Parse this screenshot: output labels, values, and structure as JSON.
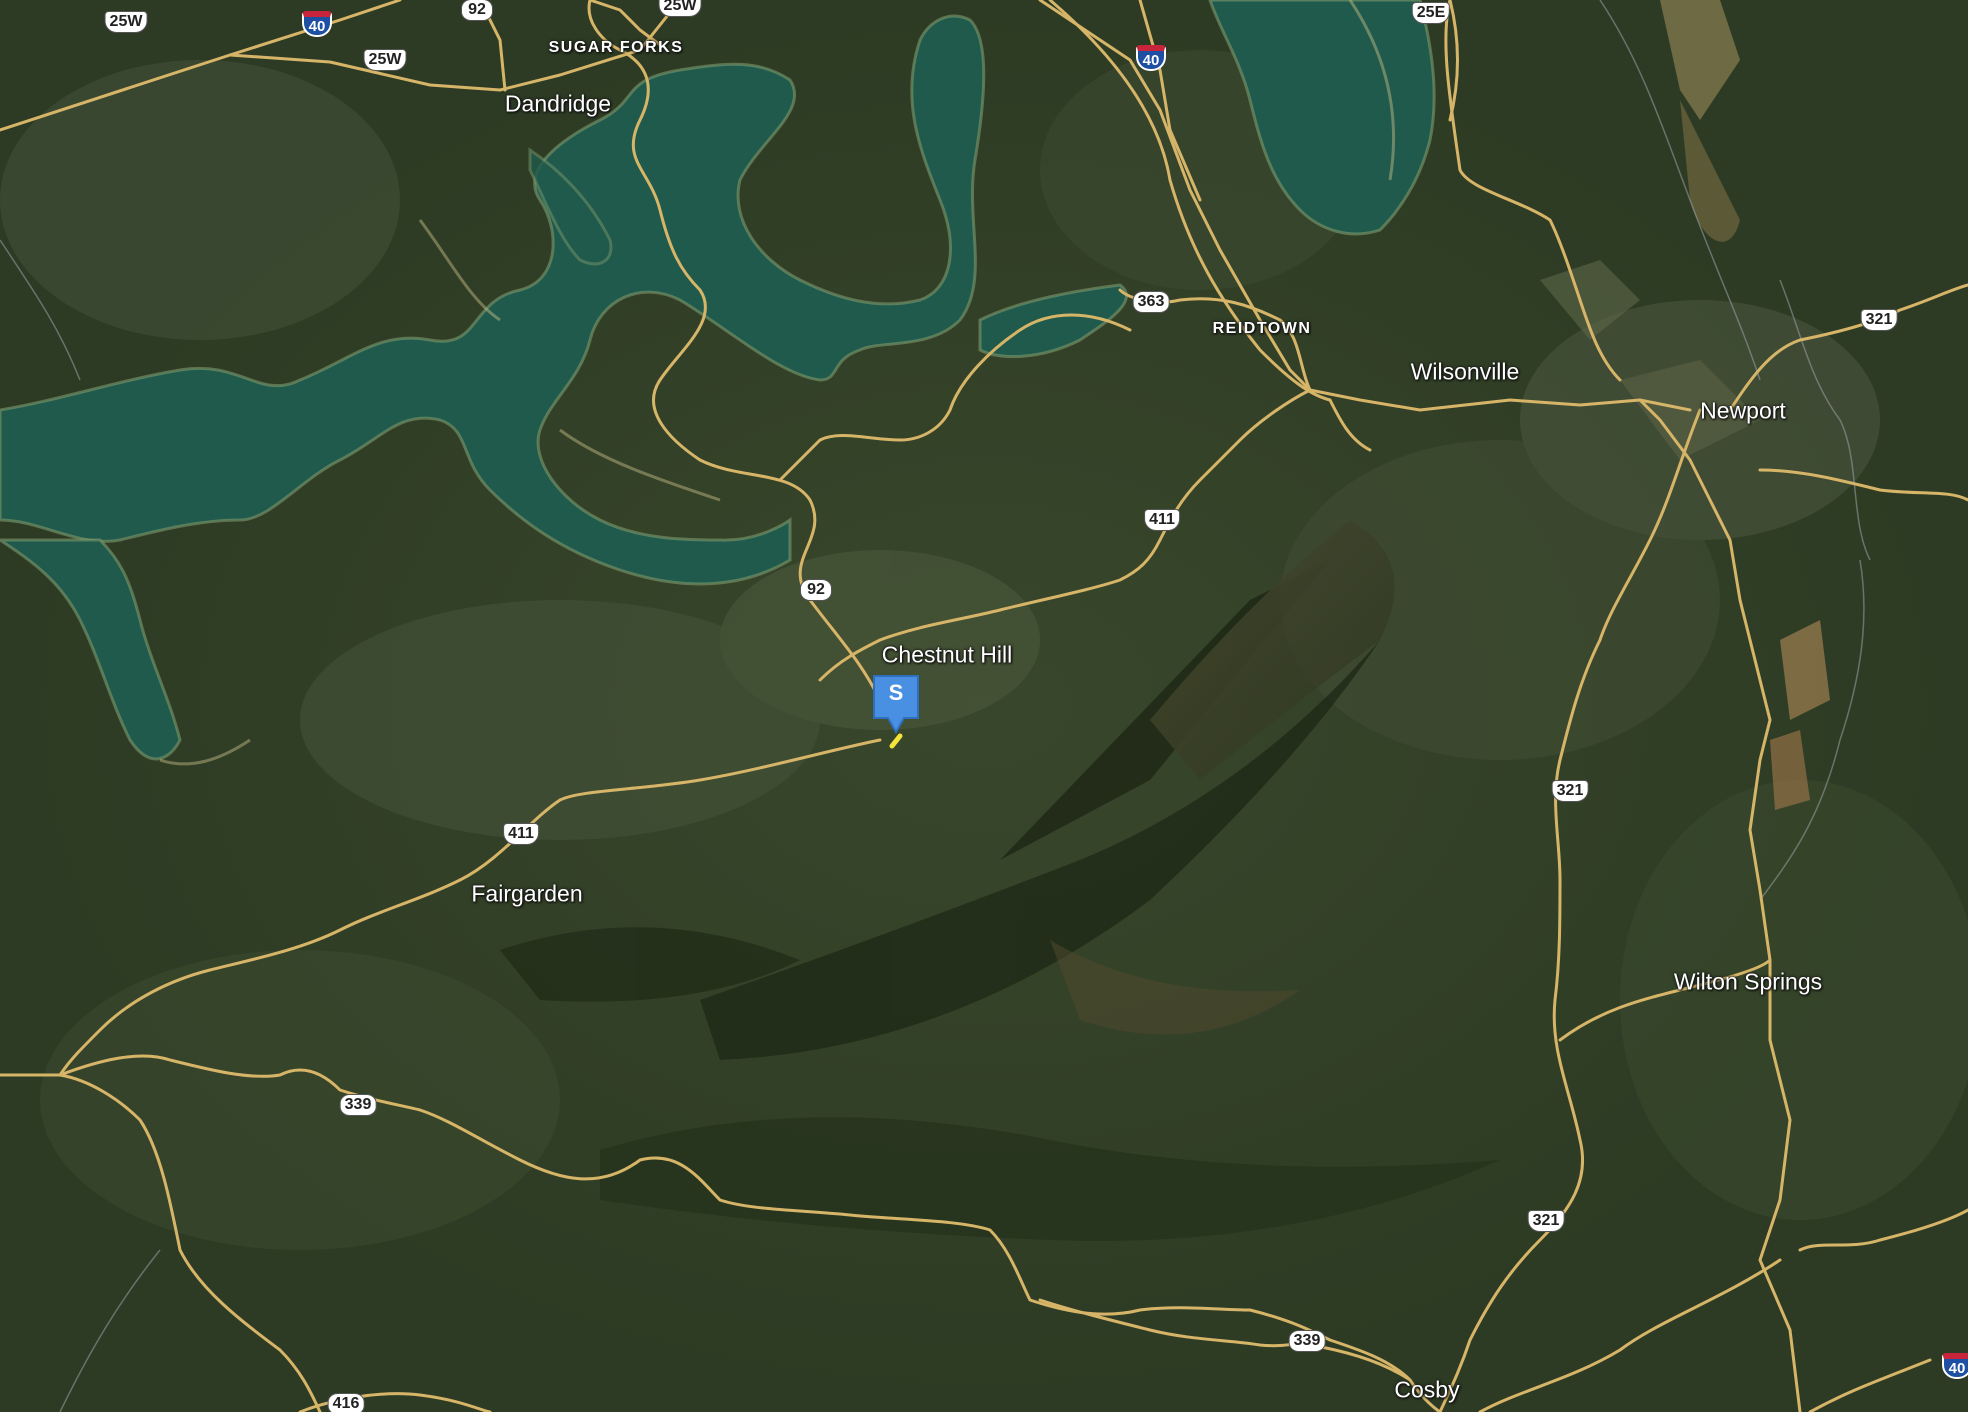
{
  "map": {
    "type": "satellite",
    "places": {
      "dandridge": "Dandridge",
      "sugar_forks": "SUGAR FORKS",
      "reidtown": "REIDTOWN",
      "wilsonville": "Wilsonville",
      "newport": "Newport",
      "chestnut_hill": "Chestnut Hill",
      "fairgarden": "Fairgarden",
      "wilton_springs": "Wilton Springs",
      "cosby": "Cosby"
    },
    "shields": {
      "us25w_a": "25W",
      "i40_a": "40",
      "r92_a": "92",
      "us25w_b": "25W",
      "us25w_c": "25W",
      "i40_b": "40",
      "us25e": "25E",
      "r363": "363",
      "us321_a": "321",
      "us411_a": "411",
      "r92_b": "92",
      "us411_b": "411",
      "us321_b": "321",
      "r339_a": "339",
      "us321_c": "321",
      "r339_b": "339",
      "r416": "416",
      "i40_c": "40"
    },
    "marker": {
      "label": "S",
      "color": "#4a90e2",
      "icon": "start-marker-icon"
    },
    "colors": {
      "water": "#1f5a4c",
      "forest": "#2f3d24",
      "road": "#d7b568",
      "boundary": "#9aa0a6"
    }
  }
}
